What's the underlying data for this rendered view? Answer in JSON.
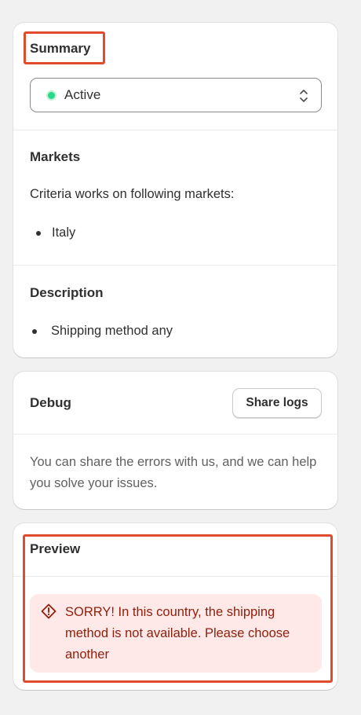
{
  "summary": {
    "title": "Summary",
    "status": {
      "value": "Active",
      "dot_color": "#29d98b"
    }
  },
  "markets": {
    "title": "Markets",
    "text": "Criteria works on following markets:",
    "items": [
      "Italy"
    ]
  },
  "description": {
    "title": "Description",
    "items": [
      "Shipping method any"
    ]
  },
  "debug": {
    "title": "Debug",
    "share_button_label": "Share logs",
    "text": "You can share the errors with us, and we can help you solve your issues."
  },
  "preview": {
    "title": "Preview",
    "error_message": "SORRY! In this country, the shipping method is not available. Please choose another",
    "icon": "alert-diamond-icon"
  },
  "colors": {
    "highlight": "#e04b2e",
    "error_bg": "#fee9e8",
    "error_text": "#8e1f0b"
  }
}
